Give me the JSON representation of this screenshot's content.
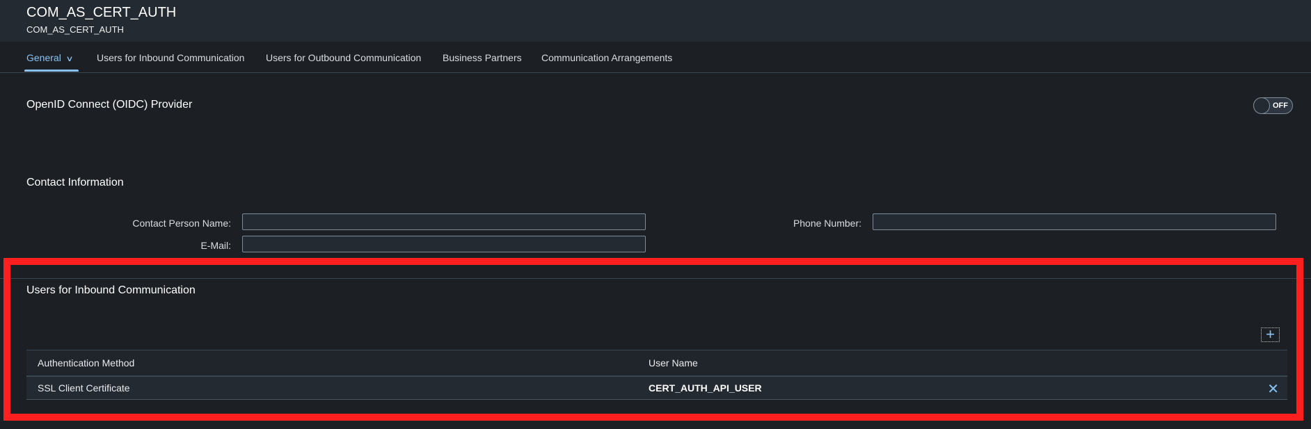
{
  "header": {
    "title": "COM_AS_CERT_AUTH",
    "subtitle": "COM_AS_CERT_AUTH"
  },
  "tabs": [
    {
      "label": "General",
      "active": true,
      "has_dropdown": true
    },
    {
      "label": "Users for Inbound Communication",
      "active": false
    },
    {
      "label": "Users for Outbound Communication",
      "active": false
    },
    {
      "label": "Business Partners",
      "active": false
    },
    {
      "label": "Communication Arrangements",
      "active": false
    }
  ],
  "oidc": {
    "title": "OpenID Connect (OIDC) Provider",
    "toggle_state": "OFF"
  },
  "contact": {
    "title": "Contact Information",
    "fields": {
      "contact_person_name": {
        "label": "Contact Person Name:",
        "value": ""
      },
      "email": {
        "label": "E-Mail:",
        "value": ""
      },
      "phone_number": {
        "label": "Phone Number:",
        "value": ""
      }
    }
  },
  "inbound_users": {
    "title": "Users for Inbound Communication",
    "add_icon": "plus-icon",
    "columns": [
      "Authentication Method",
      "User Name"
    ],
    "rows": [
      {
        "authentication_method": "SSL Client Certificate",
        "user_name": "CERT_AUTH_API_USER",
        "delete_icon": "close-icon"
      }
    ]
  },
  "annotation": {
    "highlight_color": "#ff1f1f"
  }
}
